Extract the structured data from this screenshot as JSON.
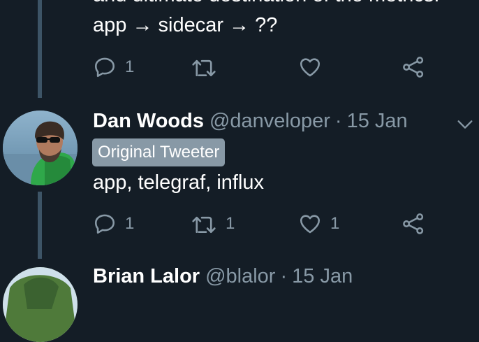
{
  "previous_tweet": {
    "text_line1": "and ultimate destination of the metrics.",
    "text_line2": "app → sidecar → ??",
    "actions": {
      "reply_count": "1",
      "retweet_count": "",
      "like_count": ""
    }
  },
  "tweet": {
    "name": "Dan Woods",
    "handle": "@danveloper",
    "separator": "·",
    "date": "15 Jan",
    "badge": "Original Tweeter",
    "text": "app, telegraf, influx",
    "actions": {
      "reply_count": "1",
      "retweet_count": "1",
      "like_count": "1"
    }
  },
  "next_tweet": {
    "name": "Brian Lalor",
    "handle": "@blalor",
    "separator": "·",
    "date": "15 Jan"
  },
  "icons": [
    "reply-icon",
    "retweet-icon",
    "like-icon",
    "share-icon",
    "chevron-down-icon"
  ],
  "colors": {
    "background": "#141d26",
    "muted": "#8899a6",
    "thread_line": "#3d5466"
  }
}
